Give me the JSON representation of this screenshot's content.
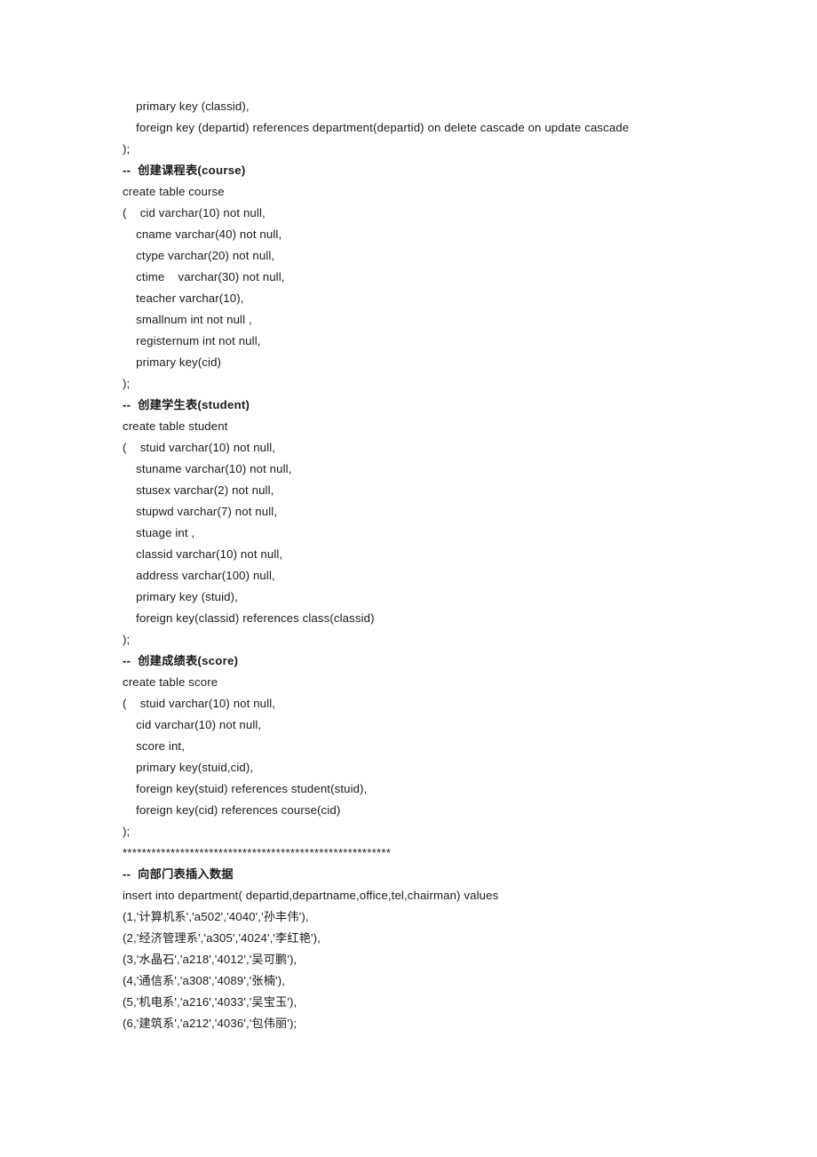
{
  "document": {
    "background_color": "#ffffff",
    "text_color": "#1a1a1a",
    "lines": [
      {
        "text": "    primary key (classid),",
        "style": "normal"
      },
      {
        "text": "    foreign key (departid) references department(departid) on delete cascade on update cascade",
        "style": "normal"
      },
      {
        "text": ");",
        "style": "normal"
      },
      {
        "text": "--  创建课程表(course)",
        "style": "comment"
      },
      {
        "text": "create table course",
        "style": "normal"
      },
      {
        "text": "(    cid varchar(10) not null,",
        "style": "normal"
      },
      {
        "text": "    cname varchar(40) not null,",
        "style": "normal"
      },
      {
        "text": "    ctype varchar(20) not null,",
        "style": "normal"
      },
      {
        "text": "    ctime    varchar(30) not null,",
        "style": "normal"
      },
      {
        "text": "    teacher varchar(10),",
        "style": "normal"
      },
      {
        "text": "    smallnum int not null ,",
        "style": "normal"
      },
      {
        "text": "    registernum int not null,",
        "style": "normal"
      },
      {
        "text": "    primary key(cid)",
        "style": "normal"
      },
      {
        "text": ");",
        "style": "normal"
      },
      {
        "text": "--  创建学生表(student)",
        "style": "comment"
      },
      {
        "text": "create table student",
        "style": "normal"
      },
      {
        "text": "(    stuid varchar(10) not null,",
        "style": "normal"
      },
      {
        "text": "    stuname varchar(10) not null,",
        "style": "normal"
      },
      {
        "text": "    stusex varchar(2) not null,",
        "style": "normal"
      },
      {
        "text": "    stupwd varchar(7) not null,",
        "style": "normal"
      },
      {
        "text": "    stuage int ,",
        "style": "normal"
      },
      {
        "text": "    classid varchar(10) not null,",
        "style": "normal"
      },
      {
        "text": "    address varchar(100) null,",
        "style": "normal"
      },
      {
        "text": "    primary key (stuid),",
        "style": "normal"
      },
      {
        "text": "    foreign key(classid) references class(classid)",
        "style": "normal"
      },
      {
        "text": ");",
        "style": "normal"
      },
      {
        "text": "--  创建成绩表(score)",
        "style": "comment"
      },
      {
        "text": "create table score",
        "style": "normal"
      },
      {
        "text": "(    stuid varchar(10) not null,",
        "style": "normal"
      },
      {
        "text": "    cid varchar(10) not null,",
        "style": "normal"
      },
      {
        "text": "    score int,",
        "style": "normal"
      },
      {
        "text": "    primary key(stuid,cid),",
        "style": "normal"
      },
      {
        "text": "    foreign key(stuid) references student(stuid),",
        "style": "normal"
      },
      {
        "text": "    foreign key(cid) references course(cid)",
        "style": "normal"
      },
      {
        "text": ");",
        "style": "normal"
      },
      {
        "text": "********************************************************",
        "style": "stars"
      },
      {
        "text": "--  向部门表插入数据",
        "style": "comment"
      },
      {
        "text": "insert into department( departid,departname,office,tel,chairman) values",
        "style": "normal"
      },
      {
        "text": "(1,'计算机系','a502','4040','孙丰伟'),",
        "style": "normal"
      },
      {
        "text": "(2,'经济管理系','a305','4024','李红艳'),",
        "style": "normal"
      },
      {
        "text": "(3,'水晶石','a218','4012','吴可鹏'),",
        "style": "normal"
      },
      {
        "text": "(4,'通信系','a308','4089','张楠'),",
        "style": "normal"
      },
      {
        "text": "(5,'机电系','a216','4033','吴宝玉'),",
        "style": "normal"
      },
      {
        "text": "(6,'建筑系','a212','4036','包伟丽');",
        "style": "normal"
      }
    ]
  }
}
